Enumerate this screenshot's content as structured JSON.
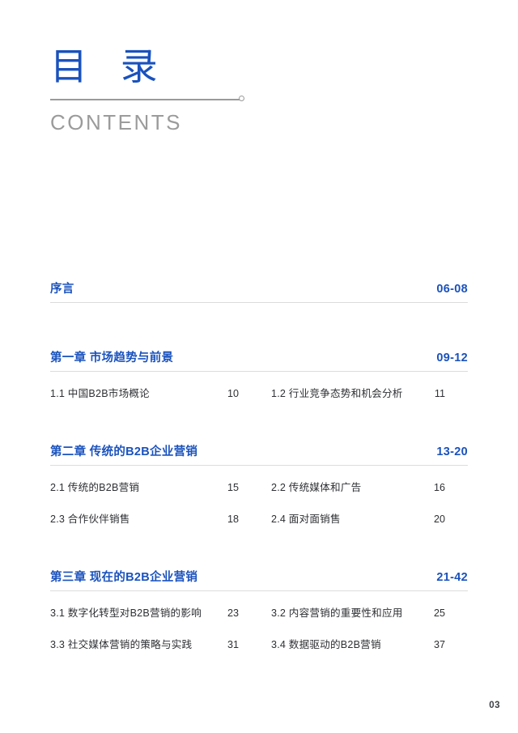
{
  "header": {
    "title_cn": "目 录",
    "title_en": "CONTENTS",
    "rule_icon": "line-with-circle-endpoint"
  },
  "colors": {
    "accent_blue": "#1a52bd",
    "subtitle_gray": "#9b9b9b",
    "rule_gray": "#9a9a9a",
    "divider_gray": "#dcdcdc",
    "body_text": "#2f3034",
    "page_number": "#3d4044"
  },
  "toc": {
    "sections": [
      {
        "title": "序言",
        "pages": "06-08",
        "subitems": []
      },
      {
        "title": "第一章  市场趋势与前景",
        "pages": "09-12",
        "subitems": [
          {
            "label": "1.1  中国B2B市场概论",
            "page": "10"
          },
          {
            "label": "1.2  行业竞争态势和机会分析",
            "page": "11"
          }
        ]
      },
      {
        "title": "第二章  传统的B2B企业营销",
        "pages": "13-20",
        "subitems": [
          {
            "label": "2.1  传统的B2B营销",
            "page": "15"
          },
          {
            "label": "2.2  传统媒体和广告",
            "page": "16"
          },
          {
            "label": "2.3  合作伙伴销售",
            "page": "18"
          },
          {
            "label": "2.4  面对面销售",
            "page": "20"
          }
        ]
      },
      {
        "title": "第三章  现在的B2B企业营销",
        "pages": "21-42",
        "subitems": [
          {
            "label": "3.1  数字化转型对B2B营销的影响",
            "page": "23"
          },
          {
            "label": "3.2  内容营销的重要性和应用",
            "page": "25"
          },
          {
            "label": "3.3  社交媒体营销的策略与实践",
            "page": "31"
          },
          {
            "label": "3.4  数据驱动的B2B营销",
            "page": "37"
          }
        ]
      }
    ]
  },
  "footer": {
    "page_number": "03"
  }
}
